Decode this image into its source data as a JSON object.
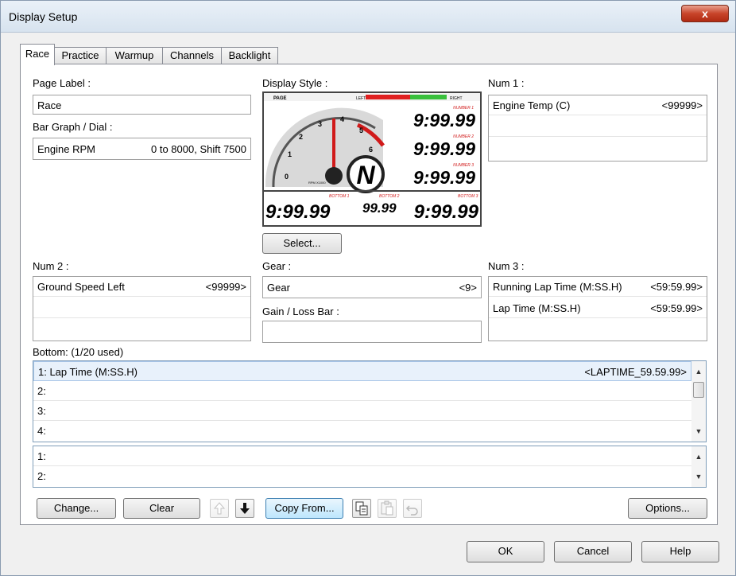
{
  "window": {
    "title": "Display Setup",
    "close_label": "x"
  },
  "tabs": [
    {
      "label": "Race"
    },
    {
      "label": "Practice"
    },
    {
      "label": "Warmup"
    },
    {
      "label": "Channels"
    },
    {
      "label": "Backlight"
    }
  ],
  "page_label": {
    "label": "Page Label :",
    "value": "Race"
  },
  "bar_graph": {
    "label": "Bar Graph / Dial :",
    "channel": "Engine RPM",
    "range": "0 to 8000, Shift 7500"
  },
  "display_style": {
    "label": "Display Style :",
    "select_label": "Select...",
    "preview": {
      "page": "PAGE",
      "left": "LEFT",
      "right": "RIGHT",
      "number1": "NUMBER 1",
      "number2": "NUMBER 2",
      "number3": "NUMBER 3",
      "value": "9:99.99",
      "bottom1": "BOTTOM 1",
      "bottom2": "BOTTOM 2",
      "bottom3": "BOTTOM 3",
      "bottom2_value": "99.99",
      "gear": "N",
      "rpm_unit": "RPM X1000",
      "dial_ticks": [
        "0",
        "1",
        "2",
        "3",
        "4",
        "5",
        "6"
      ]
    }
  },
  "num1": {
    "label": "Num 1 :",
    "rows": [
      {
        "name": "Engine Temp (C)",
        "value": "<99999>"
      }
    ]
  },
  "num2": {
    "label": "Num 2 :",
    "rows": [
      {
        "name": "Ground Speed Left",
        "value": "<99999>"
      }
    ]
  },
  "gear": {
    "label": "Gear :",
    "name": "Gear",
    "value": "<9>"
  },
  "gain_loss": {
    "label": "Gain / Loss Bar :"
  },
  "num3": {
    "label": "Num 3 :",
    "rows": [
      {
        "name": "Running Lap Time (M:SS.H)",
        "value": "<59:59.99>"
      },
      {
        "name": "Lap Time (M:SS.H)",
        "value": "<59:59.99>"
      }
    ]
  },
  "bottom": {
    "label": "Bottom: (1/20 used)",
    "rows": [
      {
        "name": "1: Lap Time (M:SS.H)",
        "value": "<LAPTIME_59.59.99>"
      },
      {
        "name": "2:",
        "value": ""
      },
      {
        "name": "3:",
        "value": ""
      },
      {
        "name": "4:",
        "value": ""
      }
    ],
    "rows2": [
      {
        "name": "1:"
      },
      {
        "name": "2:"
      }
    ]
  },
  "buttons": {
    "change": "Change...",
    "clear": "Clear",
    "copy_from": "Copy From...",
    "options": "Options...",
    "ok": "OK",
    "cancel": "Cancel",
    "help": "Help"
  }
}
